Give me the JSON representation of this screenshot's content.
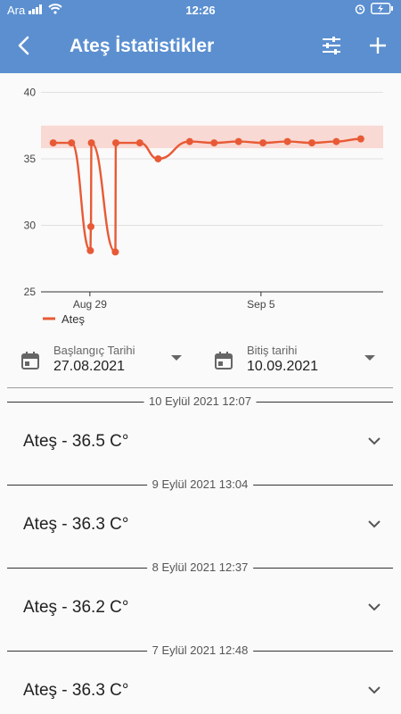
{
  "status_bar": {
    "carrier": "Ara",
    "time": "12:26"
  },
  "app_bar": {
    "title": "Ateş İstatistikler",
    "back_icon": "back-arrow-icon",
    "filter_icon": "tune-icon",
    "add_icon": "plus-icon"
  },
  "colors": {
    "primary": "#5b8fd0",
    "series": "#e85a35",
    "normal_band": "#f8d9d4"
  },
  "chart_data": {
    "type": "line",
    "x_ticks": [
      "Aug 29",
      "Sep 5"
    ],
    "y_ticks": [
      "25",
      "30",
      "35",
      "40"
    ],
    "ylim": [
      25,
      40.5
    ],
    "xlim": [
      "2021-08-27",
      "2021-09-10"
    ],
    "normal_range": [
      35.8,
      37.5
    ],
    "legend": "Ateş",
    "legend_position": "bottom-left",
    "grid": true,
    "series": [
      {
        "name": "Ateş",
        "points": [
          {
            "x": "2021-08-27 12:00",
            "y": 36.2
          },
          {
            "x": "2021-08-28 06:00",
            "y": 36.2
          },
          {
            "x": "2021-08-29 00:30",
            "y": 28.1
          },
          {
            "x": "2021-08-29 01:00",
            "y": 29.9
          },
          {
            "x": "2021-08-29 01:30",
            "y": 36.2
          },
          {
            "x": "2021-08-30 01:00",
            "y": 28.0
          },
          {
            "x": "2021-08-30 01:30",
            "y": 36.2
          },
          {
            "x": "2021-08-31 01:00",
            "y": 36.2
          },
          {
            "x": "2021-08-31 19:00",
            "y": 35.0
          },
          {
            "x": "2021-09-02 02:00",
            "y": 36.3
          },
          {
            "x": "2021-09-03 02:00",
            "y": 36.2
          },
          {
            "x": "2021-09-04 02:00",
            "y": 36.3
          },
          {
            "x": "2021-09-05 02:00",
            "y": 36.2
          },
          {
            "x": "2021-09-06 02:00",
            "y": 36.3
          },
          {
            "x": "2021-09-07 02:00",
            "y": 36.2
          },
          {
            "x": "2021-09-08 02:00",
            "y": 36.3
          },
          {
            "x": "2021-09-09 02:00",
            "y": 36.5
          }
        ]
      }
    ]
  },
  "date_range": {
    "start_label": "Başlangıç Tarihi",
    "start_value": "27.08.2021",
    "end_label": "Bitiş tarihi",
    "end_value": "10.09.2021"
  },
  "entries": [
    {
      "date": "10 Eylül 2021 12:07",
      "text": "Ateş - 36.5 C°"
    },
    {
      "date": "9 Eylül 2021 13:04",
      "text": "Ateş - 36.3 C°"
    },
    {
      "date": "8 Eylül 2021 12:37",
      "text": "Ateş - 36.2 C°"
    },
    {
      "date": "7 Eylül 2021 12:48",
      "text": "Ateş - 36.3 C°"
    }
  ]
}
